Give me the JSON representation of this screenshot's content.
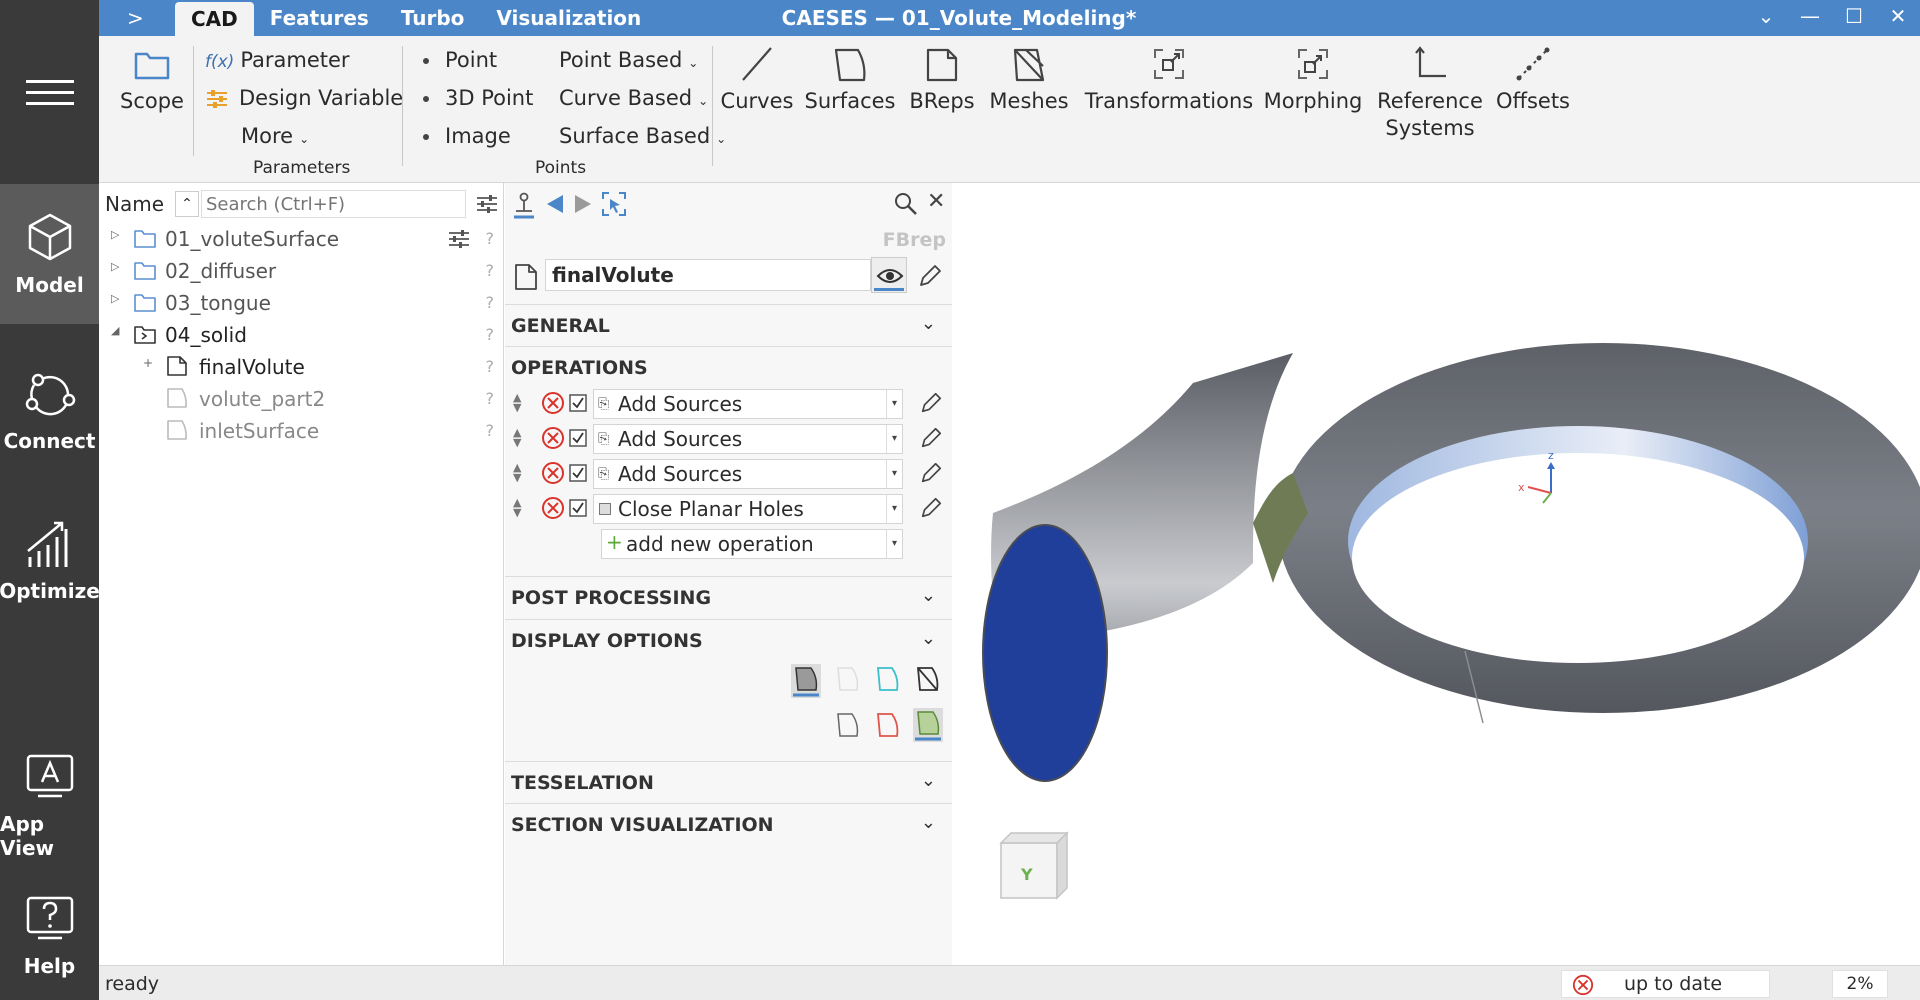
{
  "rail": {
    "items": [
      {
        "label": "Model",
        "icon": "cube-icon"
      },
      {
        "label": "Connect",
        "icon": "connect-icon"
      },
      {
        "label": "Optimize",
        "icon": "optimize-icon"
      },
      {
        "label": "App View",
        "icon": "app-view-icon"
      },
      {
        "label": "Help",
        "icon": "help-icon"
      }
    ]
  },
  "titlebar": {
    "expander": ">",
    "tabs": [
      "CAD",
      "Features",
      "Turbo",
      "Visualization"
    ],
    "title": "CAESES — 01_Volute_Modeling*",
    "controls": {
      "collapse": "⌄",
      "minimize": "—",
      "maximize": "☐",
      "close": "✕"
    }
  },
  "ribbon": {
    "scope": "Scope",
    "parameters": {
      "label": "Parameters",
      "parameter_prefix": "f(x)",
      "parameter": "Parameter",
      "design_variable": "Design Variable",
      "more": "More"
    },
    "points": {
      "label": "Points",
      "point": "Point",
      "point3d": "3D Point",
      "image": "Image",
      "point_based": "Point Based",
      "curve_based": "Curve Based",
      "surface_based": "Surface Based"
    },
    "tools": {
      "curves": "Curves",
      "surfaces": "Surfaces",
      "breps": "BReps",
      "meshes": "Meshes",
      "transformations": "Transformations",
      "morphing": "Morphing",
      "reference_line1": "Reference",
      "reference_line2": "Systems",
      "offsets": "Offsets"
    }
  },
  "tree": {
    "name_header": "Name",
    "search_placeholder": "Search (Ctrl+F)",
    "rows": [
      {
        "label": "01_voluteSurface"
      },
      {
        "label": "02_diffuser"
      },
      {
        "label": "03_tongue"
      },
      {
        "label": "04_solid"
      },
      {
        "label": "finalVolute"
      },
      {
        "label": "volute_part2"
      },
      {
        "label": "inletSurface"
      }
    ],
    "help_mark": "?"
  },
  "props": {
    "type": "FBrep",
    "name": "finalVolute",
    "sections": {
      "general": "GENERAL",
      "operations": "OPERATIONS",
      "post_processing": "POST PROCESSING",
      "display_options": "DISPLAY OPTIONS",
      "tesselation": "TESSELATION",
      "section_visualization": "SECTION VISUALIZATION"
    },
    "operations": [
      {
        "label": "Add Sources"
      },
      {
        "label": "Add Sources"
      },
      {
        "label": "Add Sources"
      },
      {
        "label": "Close Planar Holes"
      }
    ],
    "add_operation": "add new operation"
  },
  "viewport": {
    "cube_face": "Y",
    "axis_z": "z",
    "axis_x": "x"
  },
  "status": {
    "text": "ready",
    "state": "up to date",
    "percent": "2%"
  },
  "colors": {
    "accent": "#4a86c8",
    "rail": "#3a3a3a",
    "error": "#d9342b",
    "inlet": "#1f3f9a",
    "volute": "#6f737b"
  }
}
